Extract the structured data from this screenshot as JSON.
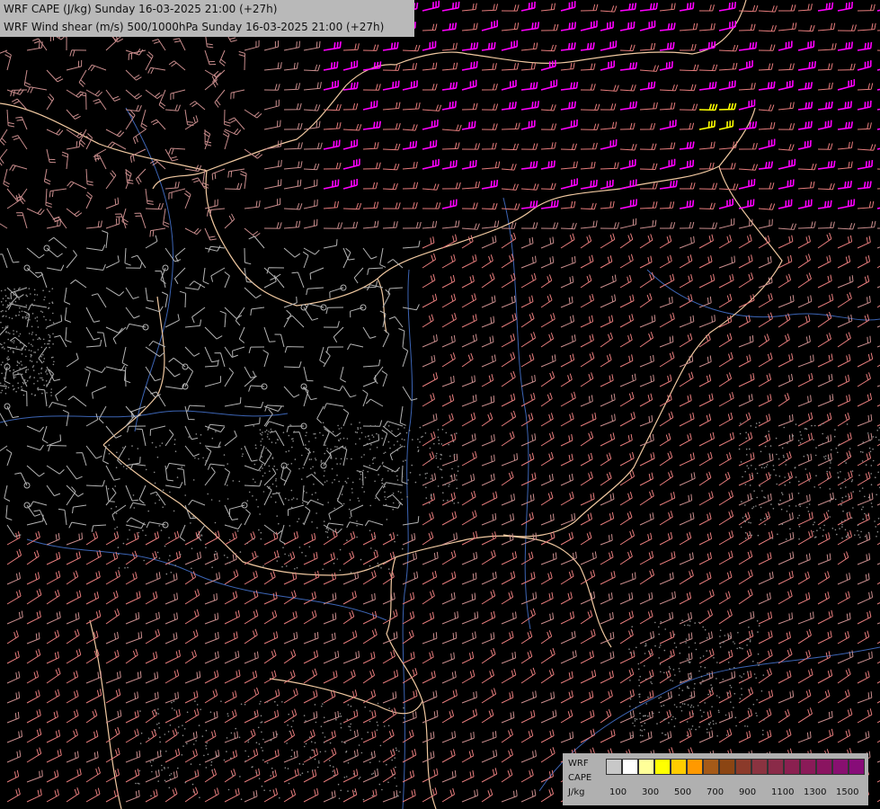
{
  "header": {
    "line1": "WRF CAPE (J/kg) Sunday 16-03-2025 21:00 (+27h)",
    "line2": "WRF Wind shear (m/s) 500/1000hPa Sunday 16-03-2025 21:00 (+27h)"
  },
  "legend": {
    "model": "WRF",
    "field": "CAPE",
    "unit": "J/kg",
    "ticks": [
      "100",
      "300",
      "500",
      "700",
      "900",
      "1100",
      "1300",
      "1500"
    ],
    "colors": [
      "#c8c8c8",
      "#ffffff",
      "#ffff99",
      "#ffff00",
      "#ffcc00",
      "#ff9900",
      "#a55a18",
      "#8b4513",
      "#8b3a2a",
      "#8a3340",
      "#8a2a48",
      "#8a2050",
      "#8a1a58",
      "#8a1460",
      "#881070",
      "#870c78"
    ]
  },
  "colors": {
    "background": "#000000",
    "border": "#f0c8a0",
    "river": "#3c64b4",
    "barb_calm": "#b4b4b4",
    "barb_mid": "#c88c8c",
    "barb_strong": "#e67c7c",
    "barb_high": "#ff00ff",
    "barb_cape": "#ffff00"
  }
}
